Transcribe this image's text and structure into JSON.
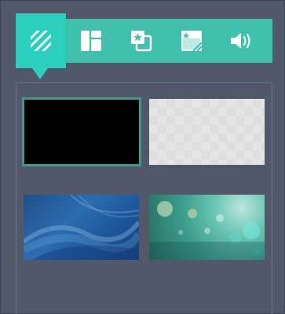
{
  "toolbar": {
    "tabs": [
      {
        "icon": "background-stripes-icon",
        "active": true
      },
      {
        "icon": "layout-panels-icon",
        "active": false
      },
      {
        "icon": "sticker-image-icon",
        "active": false
      },
      {
        "icon": "frame-effect-icon",
        "active": false
      },
      {
        "icon": "speaker-volume-icon",
        "active": false
      }
    ],
    "colors": {
      "bar": "#3fc1ae",
      "active_tab": "#2ad0bd",
      "icon": "#ffffff"
    }
  },
  "backgrounds": {
    "selected_index": 0,
    "items": [
      {
        "name": "black"
      },
      {
        "name": "transparent-checkerboard"
      },
      {
        "name": "blue-wave"
      },
      {
        "name": "teal-bokeh"
      }
    ]
  },
  "page": {
    "background": "#505869",
    "accent": "#3a9b8c"
  }
}
